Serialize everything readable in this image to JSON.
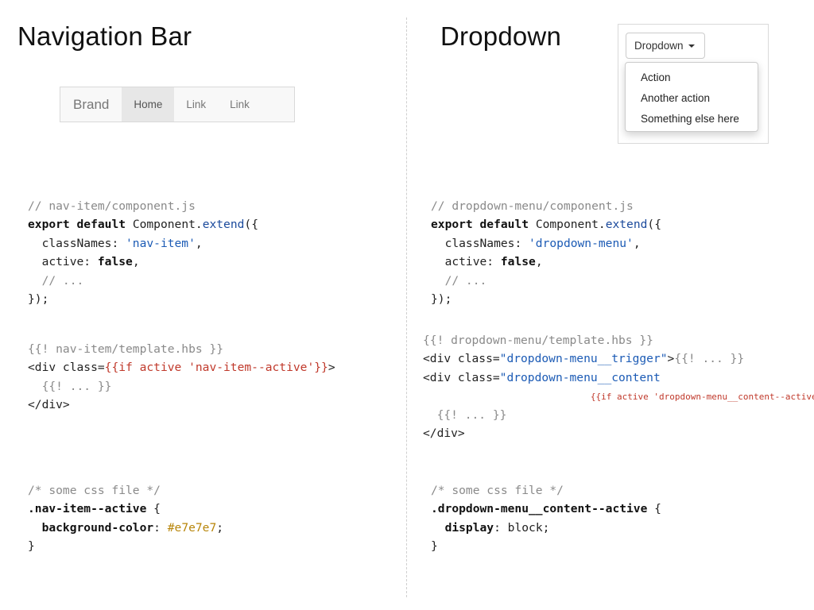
{
  "left": {
    "title": "Navigation Bar",
    "navbar": {
      "brand": "Brand",
      "items": [
        "Home",
        "Link",
        "Link"
      ]
    },
    "js": {
      "comment": "// nav-item/component.js",
      "kw_export": "export",
      "kw_default": "default",
      "obj": "Component.",
      "method": "extend",
      "open": "({",
      "class_key": "classNames: ",
      "class_val": "'nav-item'",
      "comma": ",",
      "active_key": "active: ",
      "active_val": "false",
      "ellipsis": "// ...",
      "close": "});"
    },
    "hbs": {
      "comment": "{{! nav-item/template.hbs }}",
      "line1_a": "<div class=",
      "line1_b": "{{if active 'nav-item--active'}}",
      "line1_c": ">",
      "line2": "{{! ... }}",
      "line3": "</div>"
    },
    "css": {
      "comment": "/* some css file */",
      "selector": ".nav-item--active",
      "brace_open": " {",
      "prop": "background-color",
      "colon": ": ",
      "value": "#e7e7e7",
      "semi": ";",
      "brace_close": "}"
    }
  },
  "right": {
    "title": "Dropdown",
    "dropdown": {
      "button_label": "Dropdown",
      "items": [
        "Action",
        "Another action",
        "Something else here"
      ]
    },
    "js": {
      "comment": "// dropdown-menu/component.js",
      "kw_export": "export",
      "kw_default": "default",
      "obj": "Component.",
      "method": "extend",
      "open": "({",
      "class_key": "classNames: ",
      "class_val": "'dropdown-menu'",
      "comma": ",",
      "active_key": "active: ",
      "active_val": "false",
      "ellipsis": "// ...",
      "close": "});"
    },
    "hbs": {
      "comment": "{{! dropdown-menu/template.hbs }}",
      "l1_a": "<div class=",
      "l1_b": "\"dropdown-menu__trigger\"",
      "l1_c": ">",
      "l1_d": "{{! ... }}",
      "l2_a": "<div class=",
      "l2_b": "\"dropdown-menu__content",
      "l3_a": "{{if active 'dropdown-menu__content--active'}}",
      "l3_b": "\">",
      "l4": "{{! ... }}",
      "l5": "</div>"
    },
    "css": {
      "comment": "/* some css file */",
      "selector": ".dropdown-menu__content--active",
      "brace_open": " {",
      "prop": "display",
      "colon": ": ",
      "value": "block",
      "semi": ";",
      "brace_close": "}"
    }
  }
}
